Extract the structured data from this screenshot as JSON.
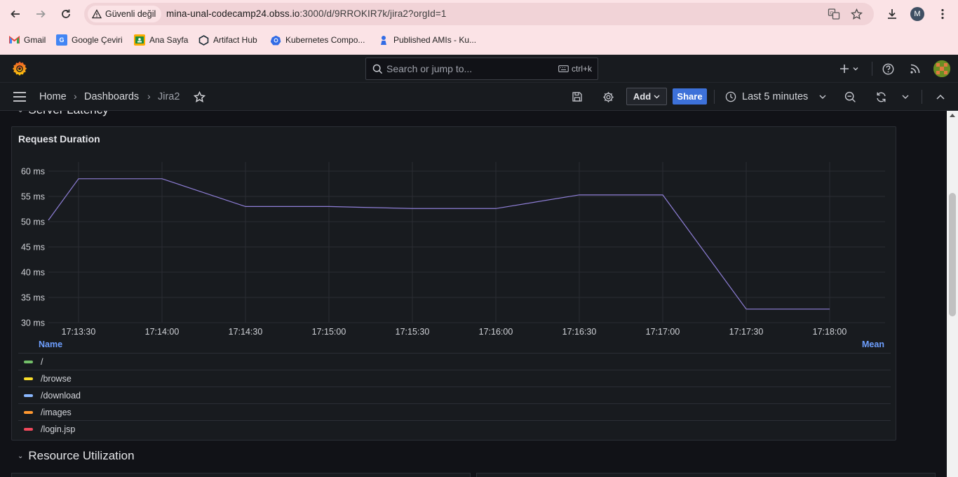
{
  "browser": {
    "security_label": "Güvenli değil",
    "url_host": "mina-unal-codecamp24.obss.io",
    "url_rest": ":3000/d/9RROKIR7k/jira2?orgId=1",
    "profile_initial": "M",
    "bookmarks": [
      {
        "label": "Gmail",
        "icon": "gmail-icon",
        "color": "#ea4335"
      },
      {
        "label": "Google Çeviri",
        "icon": "google-translate-icon",
        "color": "#4285f4"
      },
      {
        "label": "Ana Sayfa",
        "icon": "classroom-icon",
        "color": "#1e8e3e"
      },
      {
        "label": "Artifact Hub",
        "icon": "artifact-hub-icon",
        "color": "#1c2c35"
      },
      {
        "label": "Kubernetes Compo...",
        "icon": "kubernetes-icon",
        "color": "#326ce5"
      },
      {
        "label": "Published AMIs - Ku...",
        "icon": "kops-icon",
        "color": "#326ce5"
      }
    ]
  },
  "grafana": {
    "search_placeholder": "Search or jump to...",
    "search_shortcut": "ctrl+k",
    "breadcrumb": [
      "Home",
      "Dashboards",
      "Jira2"
    ],
    "add_label": "Add",
    "share_label": "Share",
    "time_range": "Last 5 minutes",
    "accent": "#3d71d9"
  },
  "rows": {
    "server_latency": "Server Latency",
    "resource_utilization": "Resource Utilization"
  },
  "panel": {
    "title": "Request Duration",
    "legend_name_header": "Name",
    "legend_mean_header": "Mean",
    "legend": [
      {
        "label": "/",
        "color": "#73bf69"
      },
      {
        "label": "/browse",
        "color": "#fade2a"
      },
      {
        "label": "/download",
        "color": "#8ab8ff"
      },
      {
        "label": "/images",
        "color": "#ff9830"
      },
      {
        "label": "/login.jsp",
        "color": "#f2495c"
      }
    ]
  },
  "chart_data": {
    "type": "line",
    "title": "Request Duration",
    "x_ticks": [
      "17:13:30",
      "17:14:00",
      "17:14:30",
      "17:15:00",
      "17:15:30",
      "17:16:00",
      "17:16:30",
      "17:17:00",
      "17:17:30",
      "17:18:00"
    ],
    "y_ticks": [
      "30 ms",
      "35 ms",
      "40 ms",
      "45 ms",
      "50 ms",
      "55 ms",
      "60 ms"
    ],
    "ylim": [
      30,
      60
    ],
    "grid": true,
    "series": [
      {
        "color": "#8f7fd8",
        "points": [
          {
            "x": "17:13:19",
            "y": 50.3
          },
          {
            "x": "17:13:30",
            "y": 58.5
          },
          {
            "x": "17:14:00",
            "y": 58.5
          },
          {
            "x": "17:14:30",
            "y": 53.0
          },
          {
            "x": "17:15:00",
            "y": 53.0
          },
          {
            "x": "17:15:30",
            "y": 52.6
          },
          {
            "x": "17:16:00",
            "y": 52.6
          },
          {
            "x": "17:16:30",
            "y": 55.3
          },
          {
            "x": "17:17:00",
            "y": 55.3
          },
          {
            "x": "17:17:30",
            "y": 32.7
          },
          {
            "x": "17:18:00",
            "y": 32.7
          }
        ]
      }
    ]
  }
}
